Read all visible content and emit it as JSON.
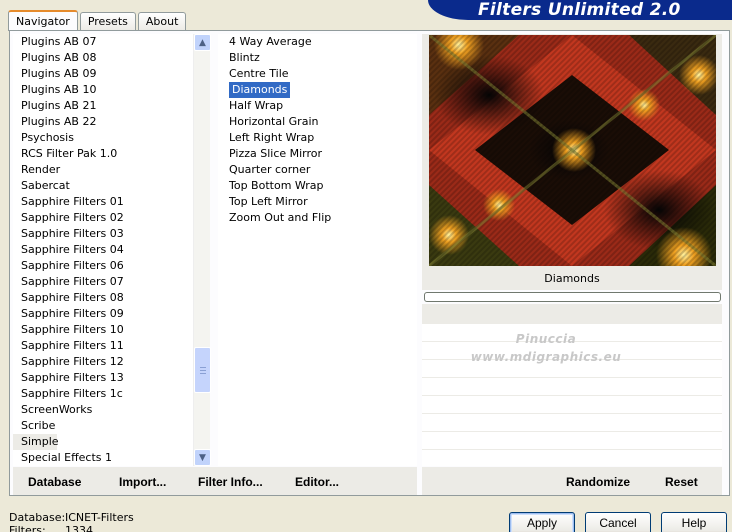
{
  "tabs": [
    "Navigator",
    "Presets",
    "About"
  ],
  "banner_title": "Filters Unlimited 2.0",
  "categories": [
    {
      "label": "Plugins AB 07"
    },
    {
      "label": "Plugins AB 08"
    },
    {
      "label": "Plugins AB 09"
    },
    {
      "label": "Plugins AB 10"
    },
    {
      "label": "Plugins AB 21"
    },
    {
      "label": "Plugins AB 22"
    },
    {
      "label": "Psychosis"
    },
    {
      "label": "RCS Filter Pak 1.0"
    },
    {
      "label": "Render"
    },
    {
      "label": "Sabercat"
    },
    {
      "label": "Sapphire Filters 01"
    },
    {
      "label": "Sapphire Filters 02"
    },
    {
      "label": "Sapphire Filters 03"
    },
    {
      "label": "Sapphire Filters 04"
    },
    {
      "label": "Sapphire Filters 06"
    },
    {
      "label": "Sapphire Filters 07"
    },
    {
      "label": "Sapphire Filters 08"
    },
    {
      "label": "Sapphire Filters 09"
    },
    {
      "label": "Sapphire Filters 10"
    },
    {
      "label": "Sapphire Filters 11"
    },
    {
      "label": "Sapphire Filters 12"
    },
    {
      "label": "Sapphire Filters 13"
    },
    {
      "label": "Sapphire Filters 1c"
    },
    {
      "label": "ScreenWorks"
    },
    {
      "label": "Scribe"
    },
    {
      "label": "Simple",
      "selected": true
    },
    {
      "label": "Special Effects 1"
    }
  ],
  "filters": [
    {
      "label": "4 Way Average"
    },
    {
      "label": "Blintz"
    },
    {
      "label": "Centre Tile"
    },
    {
      "label": "Diamonds",
      "selected": true
    },
    {
      "label": "Half Wrap"
    },
    {
      "label": "Horizontal Grain"
    },
    {
      "label": "Left Right Wrap"
    },
    {
      "label": "Pizza Slice Mirror"
    },
    {
      "label": "Quarter corner"
    },
    {
      "label": "Top Bottom Wrap"
    },
    {
      "label": "Top Left Mirror"
    },
    {
      "label": "Zoom Out and Flip"
    }
  ],
  "preview": {
    "filter_name": "Diamonds"
  },
  "watermark": {
    "line1": "Pinuccia",
    "line2": "www.mdigraphics.eu"
  },
  "buttons_left": {
    "database": "Database",
    "import": "Import...",
    "filter_info": "Filter Info...",
    "editor": "Editor..."
  },
  "buttons_right": {
    "randomize": "Randomize",
    "reset": "Reset"
  },
  "status": {
    "database_label": "Database:",
    "database_value": "ICNET-Filters",
    "filters_label": "Filters:",
    "filters_value": "1334"
  },
  "dialog_buttons": {
    "apply": "Apply",
    "cancel": "Cancel",
    "help": "Help"
  },
  "colors": {
    "banner": "#0a2a8c",
    "selection": "#316ac5",
    "active_tab_accent": "#e68b2c"
  }
}
